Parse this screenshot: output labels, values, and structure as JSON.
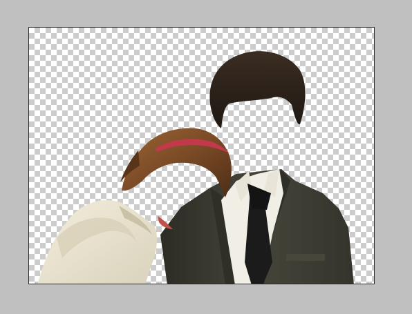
{
  "document": {
    "background": "transparent-checkerboard",
    "layers": [
      {
        "name": "woman-cutout",
        "colors": {
          "hair": "#7a4a26",
          "headband": "#c23a4a",
          "blouse": "#ece6d4",
          "lips": "#c0504a"
        }
      },
      {
        "name": "man-cutout",
        "colors": {
          "hair": "#2a211b",
          "suit": "#3d3d33",
          "shirt": "#f1eee6",
          "tie": "#1b1b1b"
        }
      }
    ]
  },
  "workspace": {
    "background_color": "#c0c0c0",
    "canvas_border_color": "#2a2a2a"
  }
}
